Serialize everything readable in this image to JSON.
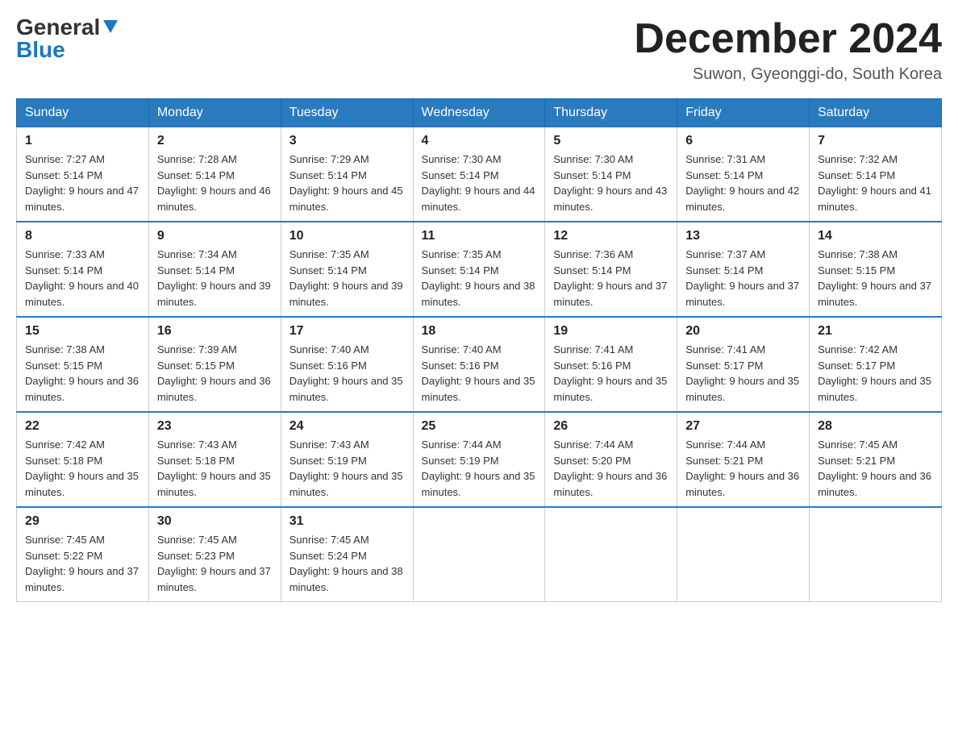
{
  "logo": {
    "general": "General",
    "blue": "Blue"
  },
  "title": "December 2024",
  "location": "Suwon, Gyeonggi-do, South Korea",
  "days_of_week": [
    "Sunday",
    "Monday",
    "Tuesday",
    "Wednesday",
    "Thursday",
    "Friday",
    "Saturday"
  ],
  "weeks": [
    [
      {
        "day": "1",
        "sunrise": "7:27 AM",
        "sunset": "5:14 PM",
        "daylight": "9 hours and 47 minutes."
      },
      {
        "day": "2",
        "sunrise": "7:28 AM",
        "sunset": "5:14 PM",
        "daylight": "9 hours and 46 minutes."
      },
      {
        "day": "3",
        "sunrise": "7:29 AM",
        "sunset": "5:14 PM",
        "daylight": "9 hours and 45 minutes."
      },
      {
        "day": "4",
        "sunrise": "7:30 AM",
        "sunset": "5:14 PM",
        "daylight": "9 hours and 44 minutes."
      },
      {
        "day": "5",
        "sunrise": "7:30 AM",
        "sunset": "5:14 PM",
        "daylight": "9 hours and 43 minutes."
      },
      {
        "day": "6",
        "sunrise": "7:31 AM",
        "sunset": "5:14 PM",
        "daylight": "9 hours and 42 minutes."
      },
      {
        "day": "7",
        "sunrise": "7:32 AM",
        "sunset": "5:14 PM",
        "daylight": "9 hours and 41 minutes."
      }
    ],
    [
      {
        "day": "8",
        "sunrise": "7:33 AM",
        "sunset": "5:14 PM",
        "daylight": "9 hours and 40 minutes."
      },
      {
        "day": "9",
        "sunrise": "7:34 AM",
        "sunset": "5:14 PM",
        "daylight": "9 hours and 39 minutes."
      },
      {
        "day": "10",
        "sunrise": "7:35 AM",
        "sunset": "5:14 PM",
        "daylight": "9 hours and 39 minutes."
      },
      {
        "day": "11",
        "sunrise": "7:35 AM",
        "sunset": "5:14 PM",
        "daylight": "9 hours and 38 minutes."
      },
      {
        "day": "12",
        "sunrise": "7:36 AM",
        "sunset": "5:14 PM",
        "daylight": "9 hours and 37 minutes."
      },
      {
        "day": "13",
        "sunrise": "7:37 AM",
        "sunset": "5:14 PM",
        "daylight": "9 hours and 37 minutes."
      },
      {
        "day": "14",
        "sunrise": "7:38 AM",
        "sunset": "5:15 PM",
        "daylight": "9 hours and 37 minutes."
      }
    ],
    [
      {
        "day": "15",
        "sunrise": "7:38 AM",
        "sunset": "5:15 PM",
        "daylight": "9 hours and 36 minutes."
      },
      {
        "day": "16",
        "sunrise": "7:39 AM",
        "sunset": "5:15 PM",
        "daylight": "9 hours and 36 minutes."
      },
      {
        "day": "17",
        "sunrise": "7:40 AM",
        "sunset": "5:16 PM",
        "daylight": "9 hours and 35 minutes."
      },
      {
        "day": "18",
        "sunrise": "7:40 AM",
        "sunset": "5:16 PM",
        "daylight": "9 hours and 35 minutes."
      },
      {
        "day": "19",
        "sunrise": "7:41 AM",
        "sunset": "5:16 PM",
        "daylight": "9 hours and 35 minutes."
      },
      {
        "day": "20",
        "sunrise": "7:41 AM",
        "sunset": "5:17 PM",
        "daylight": "9 hours and 35 minutes."
      },
      {
        "day": "21",
        "sunrise": "7:42 AM",
        "sunset": "5:17 PM",
        "daylight": "9 hours and 35 minutes."
      }
    ],
    [
      {
        "day": "22",
        "sunrise": "7:42 AM",
        "sunset": "5:18 PM",
        "daylight": "9 hours and 35 minutes."
      },
      {
        "day": "23",
        "sunrise": "7:43 AM",
        "sunset": "5:18 PM",
        "daylight": "9 hours and 35 minutes."
      },
      {
        "day": "24",
        "sunrise": "7:43 AM",
        "sunset": "5:19 PM",
        "daylight": "9 hours and 35 minutes."
      },
      {
        "day": "25",
        "sunrise": "7:44 AM",
        "sunset": "5:19 PM",
        "daylight": "9 hours and 35 minutes."
      },
      {
        "day": "26",
        "sunrise": "7:44 AM",
        "sunset": "5:20 PM",
        "daylight": "9 hours and 36 minutes."
      },
      {
        "day": "27",
        "sunrise": "7:44 AM",
        "sunset": "5:21 PM",
        "daylight": "9 hours and 36 minutes."
      },
      {
        "day": "28",
        "sunrise": "7:45 AM",
        "sunset": "5:21 PM",
        "daylight": "9 hours and 36 minutes."
      }
    ],
    [
      {
        "day": "29",
        "sunrise": "7:45 AM",
        "sunset": "5:22 PM",
        "daylight": "9 hours and 37 minutes."
      },
      {
        "day": "30",
        "sunrise": "7:45 AM",
        "sunset": "5:23 PM",
        "daylight": "9 hours and 37 minutes."
      },
      {
        "day": "31",
        "sunrise": "7:45 AM",
        "sunset": "5:24 PM",
        "daylight": "9 hours and 38 minutes."
      },
      null,
      null,
      null,
      null
    ]
  ]
}
